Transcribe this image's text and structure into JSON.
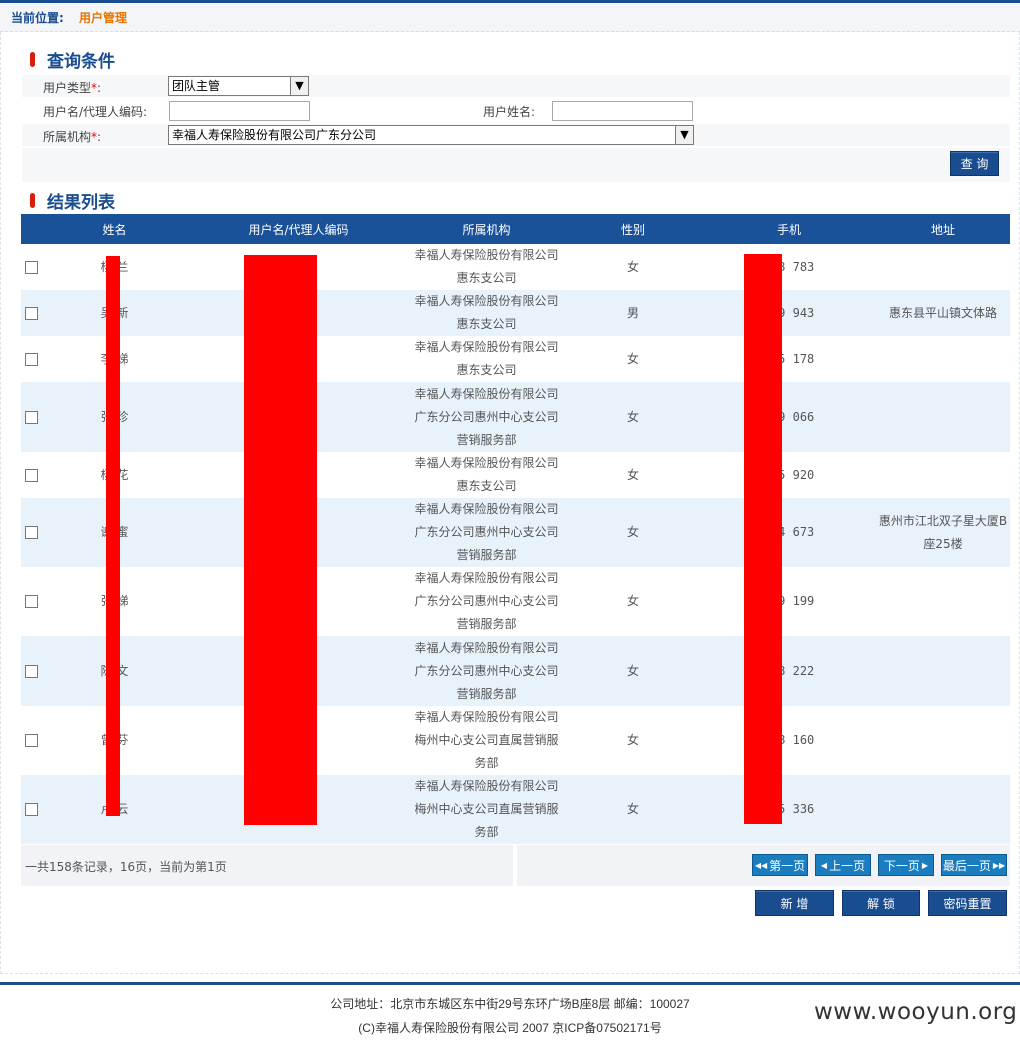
{
  "breadcrumb": {
    "label": "当前位置:",
    "current": "用户管理"
  },
  "query": {
    "title": "查询条件",
    "user_type": {
      "label": "用户类型",
      "required_mark": "*",
      "colon": ":",
      "value": "团队主管"
    },
    "user_code": {
      "label": "用户名/代理人编码:",
      "value": ""
    },
    "user_name": {
      "label": "用户姓名:",
      "value": ""
    },
    "org": {
      "label": "所属机构",
      "required_mark": "*",
      "colon": ":",
      "value": "幸福人寿保险股份有限公司广东分公司"
    },
    "search_button": "查 询"
  },
  "results": {
    "title": "结果列表",
    "columns": [
      "姓名",
      "用户名/代理人编码",
      "所属机构",
      "性别",
      "手机",
      "地址"
    ],
    "rows": [
      {
        "name": "杨 兰",
        "code": "",
        "org": "幸福人寿保险股份有限公司惠东支公司",
        "gender": "女",
        "phone": "158 783",
        "address": ""
      },
      {
        "name": "吴 新",
        "code": "",
        "org": "幸福人寿保险股份有限公司惠东支公司",
        "gender": "男",
        "phone": "159 943",
        "address": "惠东县平山镇文体路"
      },
      {
        "name": "李 娣",
        "code": "",
        "org": "幸福人寿保险股份有限公司惠东支公司",
        "gender": "女",
        "phone": "135 178",
        "address": ""
      },
      {
        "name": "张 珍",
        "code": "",
        "org": "幸福人寿保险股份有限公司广东分公司惠州中心支公司营销服务部",
        "gender": "女",
        "phone": "189 066",
        "address": ""
      },
      {
        "name": "杨 花",
        "code": "",
        "org": "幸福人寿保险股份有限公司惠东支公司",
        "gender": "女",
        "phone": "135 920",
        "address": ""
      },
      {
        "name": "谢 蜜",
        "code": "",
        "org": "幸福人寿保险股份有限公司广东分公司惠州中心支公司营销服务部",
        "gender": "女",
        "phone": "134 673",
        "address": "惠州市江北双子星大厦B座25楼"
      },
      {
        "name": "张 娣",
        "code": "",
        "org": "幸福人寿保险股份有限公司广东分公司惠州中心支公司营销服务部",
        "gender": "女",
        "phone": "139 199",
        "address": ""
      },
      {
        "name": "陈 文",
        "code": "",
        "org": "幸福人寿保险股份有限公司广东分公司惠州中心支公司营销服务部",
        "gender": "女",
        "phone": "138 222",
        "address": ""
      },
      {
        "name": "曾 芬",
        "code": "",
        "org": "幸福人寿保险股份有限公司梅州中心支公司直属营销服务部",
        "gender": "女",
        "phone": "138 160",
        "address": ""
      },
      {
        "name": "卢 云",
        "code": "",
        "org": "幸福人寿保险股份有限公司梅州中心支公司直属营销服务部",
        "gender": "女",
        "phone": "135 336",
        "address": ""
      }
    ]
  },
  "pager": {
    "summary": "一共158条记录，16页，当前为第1页",
    "first": "第一页",
    "prev": "上一页",
    "next": "下一页",
    "last": "最后一页"
  },
  "actions": {
    "add": "新  增",
    "unlock": "解  锁",
    "reset_password": "密码重置"
  },
  "footer": {
    "address": "公司地址：北京市东城区东中街29号东环广场B座8层 邮编：100027",
    "copyright": "(C)幸福人寿保险股份有限公司 2007 京ICP备07502171号"
  },
  "watermark": "www.wooyun.org",
  "colors": {
    "primary": "#1a4d8f",
    "header_bg": "#1a5299",
    "row_alt": "#e8f2fb",
    "accent": "#e67700",
    "redaction": "#ff0000"
  }
}
